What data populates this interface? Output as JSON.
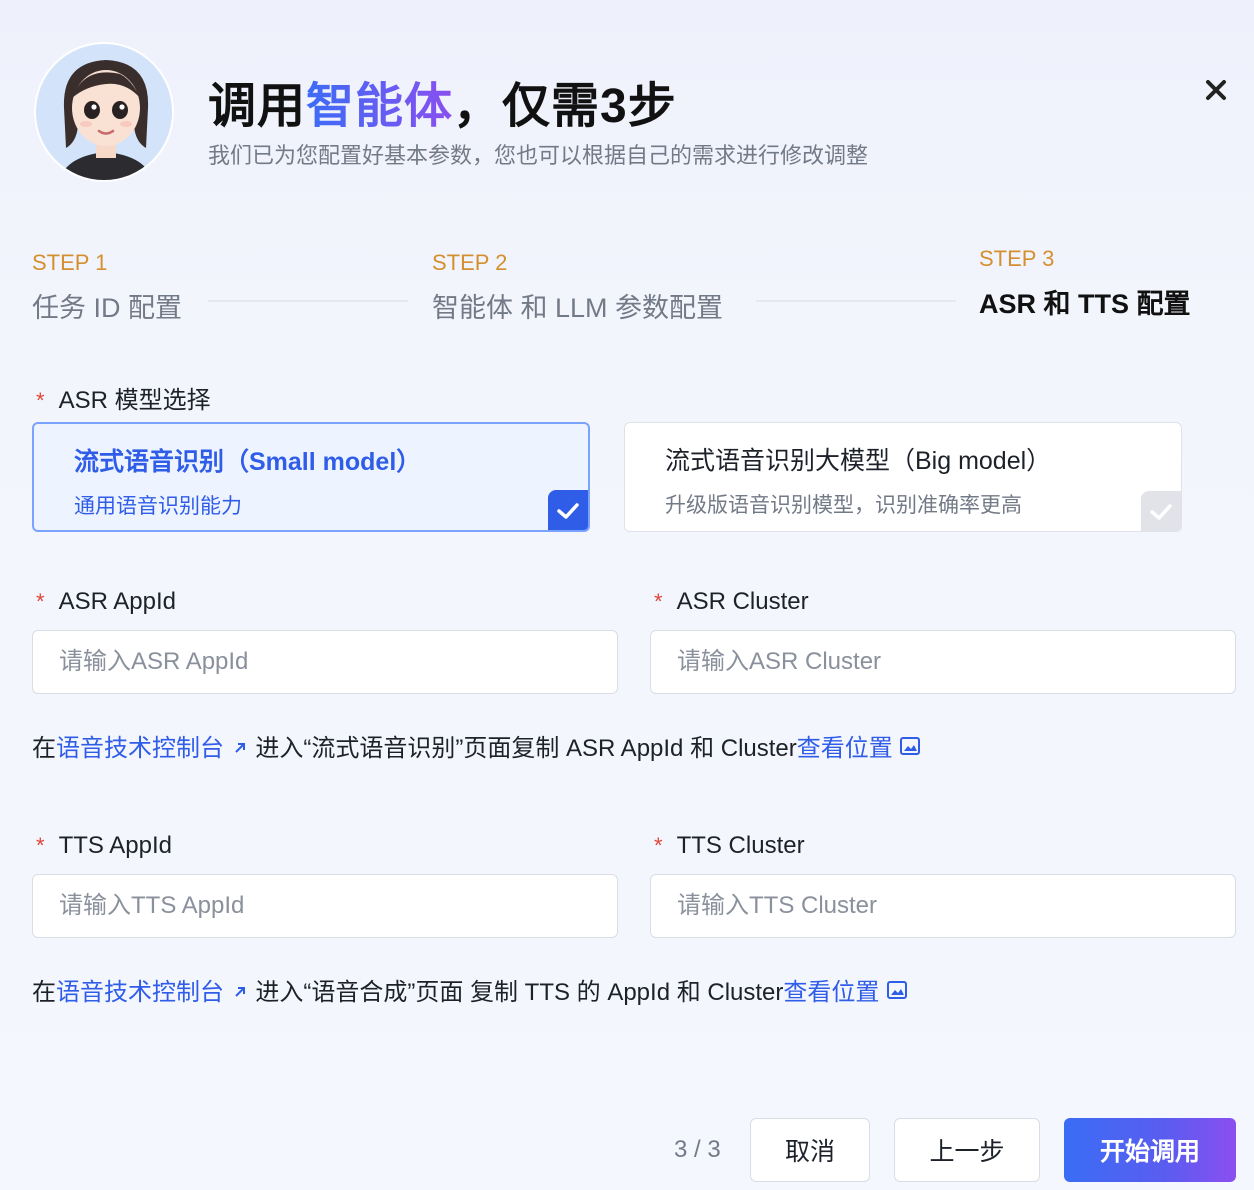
{
  "header": {
    "title_prefix": "调用",
    "title_highlight": "智能体",
    "title_suffix": "，仅需3步",
    "subtitle": "我们已为您配置好基本参数，您也可以根据自己的需求进行修改调整"
  },
  "steps": [
    {
      "num": "STEP 1",
      "label": "任务 ID 配置"
    },
    {
      "num": "STEP 2",
      "label": "智能体 和 LLM 参数配置"
    },
    {
      "num": "STEP 3",
      "label": "ASR 和 TTS 配置"
    }
  ],
  "asr_model": {
    "label": "ASR 模型选择",
    "options": [
      {
        "title": "流式语音识别（Small model）",
        "desc": "通用语音识别能力",
        "selected": true
      },
      {
        "title": "流式语音识别大模型（Big model）",
        "desc": "升级版语音识别模型，识别准确率更高",
        "selected": false
      }
    ]
  },
  "asr": {
    "appid_label": "ASR AppId",
    "appid_placeholder": "请输入ASR AppId",
    "cluster_label": "ASR Cluster",
    "cluster_placeholder": "请输入ASR Cluster",
    "hint_prefix": "在",
    "hint_link": "语音技术控制台",
    "hint_text": "进入“流式语音识别”页面复制 ASR AppId 和 Cluster",
    "hint_view": "查看位置"
  },
  "tts": {
    "appid_label": "TTS AppId",
    "appid_placeholder": "请输入TTS AppId",
    "cluster_label": "TTS Cluster",
    "cluster_placeholder": "请输入TTS Cluster",
    "hint_prefix": "在",
    "hint_link": "语音技术控制台",
    "hint_text": "进入“语音合成”页面 复制 TTS 的 AppId 和 Cluster",
    "hint_view": "查看位置"
  },
  "footer": {
    "pager": "3 / 3",
    "cancel": "取消",
    "prev": "上一步",
    "start": "开始调用"
  },
  "colors": {
    "accent": "#2f5de8",
    "step_num": "#d4902f",
    "required": "#e0463a"
  }
}
